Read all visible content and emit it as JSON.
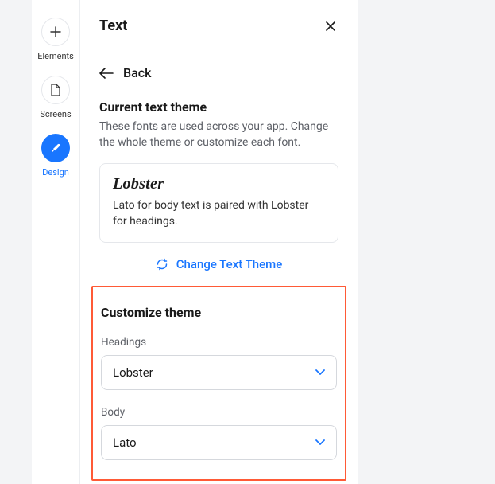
{
  "sidebar": {
    "items": [
      {
        "label": "Elements"
      },
      {
        "label": "Screens"
      },
      {
        "label": "Design"
      }
    ]
  },
  "panel": {
    "title": "Text",
    "back_label": "Back",
    "current": {
      "heading": "Current text theme",
      "description": "These fonts are used across your app. Change the whole theme or customize each font.",
      "theme_name": "Lobster",
      "theme_desc": "Lato for body text is paired with Lobster for headings."
    },
    "change_link": "Change Text Theme",
    "customize": {
      "heading": "Customize theme",
      "headings_label": "Headings",
      "headings_value": "Lobster",
      "body_label": "Body",
      "body_value": "Lato"
    }
  }
}
